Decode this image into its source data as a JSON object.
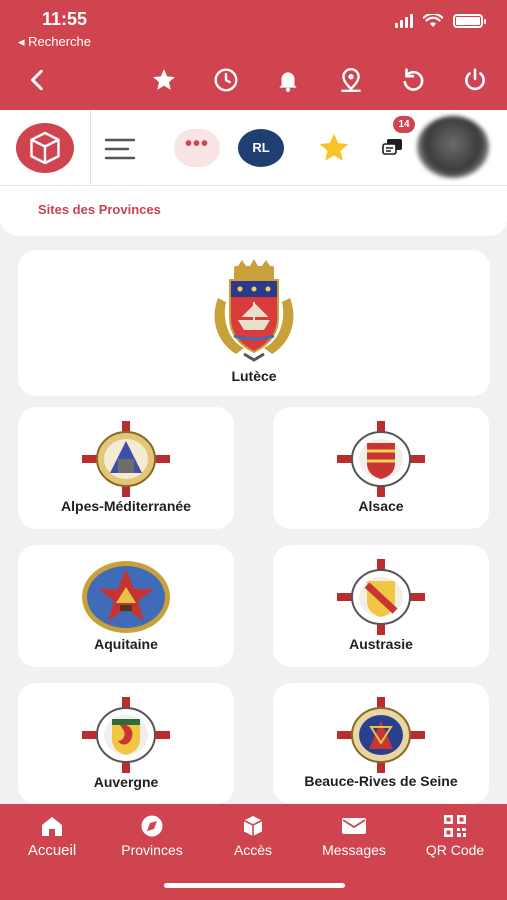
{
  "status_bar": {
    "time": "11:55",
    "back_app": "◂ Recherche"
  },
  "toolbar": {
    "rl_label": "RL",
    "dots": "•••",
    "notification_count": "14"
  },
  "section": {
    "title": "Sites des Provinces"
  },
  "provinces": [
    {
      "name": "Lutèce"
    },
    {
      "name": "Alpes-Méditerranée"
    },
    {
      "name": "Alsace"
    },
    {
      "name": "Aquitaine"
    },
    {
      "name": "Austrasie"
    },
    {
      "name": "Auvergne"
    },
    {
      "name": "Beauce-Rives de Seine"
    }
  ],
  "tabs": [
    {
      "label": "Accueil"
    },
    {
      "label": "Provinces"
    },
    {
      "label": "Accès"
    },
    {
      "label": "Messages"
    },
    {
      "label": "QR Code"
    }
  ],
  "colors": {
    "brand_red": "#d0444f",
    "accent_blue": "#1f3f73",
    "star_yellow": "#f7c325"
  }
}
